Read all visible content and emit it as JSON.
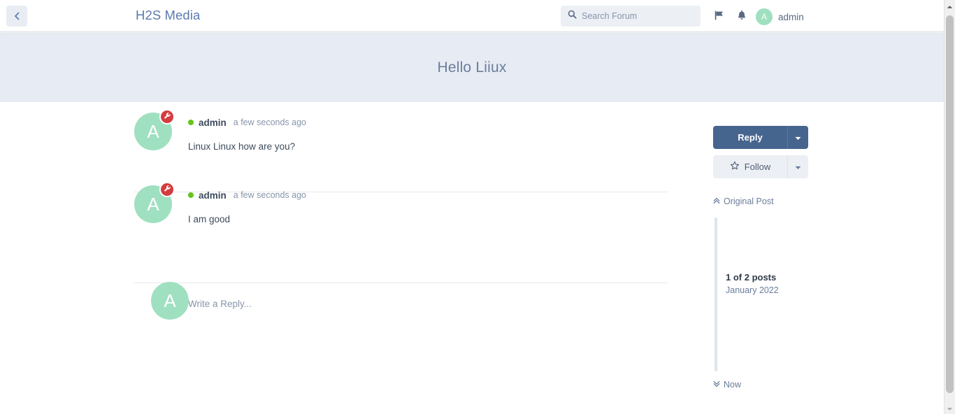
{
  "header": {
    "back_icon": "chevron-left-icon",
    "brand": "H2S Media",
    "search": {
      "icon": "search-icon",
      "placeholder": "Search Forum",
      "value": ""
    },
    "flag_icon": "flag-icon",
    "bell_icon": "bell-icon",
    "user": {
      "avatar_initial": "A",
      "name": "admin",
      "avatar_color": "#9fe0c0"
    }
  },
  "hero": {
    "title": "Hello Liiux",
    "background": "#e7ebf3"
  },
  "posts": [
    {
      "avatar_initial": "A",
      "badge_icon": "wrench-icon",
      "badge_color": "#d43c3e",
      "online": true,
      "author": "admin",
      "time": "a few seconds ago",
      "text": "Linux Linux how are you?"
    },
    {
      "avatar_initial": "A",
      "badge_icon": "wrench-icon",
      "badge_color": "#d43c3e",
      "online": true,
      "author": "admin",
      "time": "a few seconds ago",
      "text": "I am good"
    }
  ],
  "composer": {
    "avatar_initial": "A",
    "placeholder": "Write a Reply..."
  },
  "sidebar": {
    "reply_label": "Reply",
    "reply_caret_icon": "caret-down-icon",
    "reply_color": "#46658e",
    "follow_label": "Follow",
    "follow_icon": "star-outline-icon",
    "follow_caret_icon": "caret-down-icon",
    "scrubber": {
      "top_label": "Original Post",
      "top_icon": "double-chevron-up-icon",
      "count": "1 of 2 posts",
      "date": "January 2022",
      "bottom_label": "Now",
      "bottom_icon": "double-chevron-down-icon"
    }
  },
  "scrollbar": {
    "up_icon": "scroll-up-arrow-icon",
    "down_icon": "scroll-down-arrow-icon"
  }
}
